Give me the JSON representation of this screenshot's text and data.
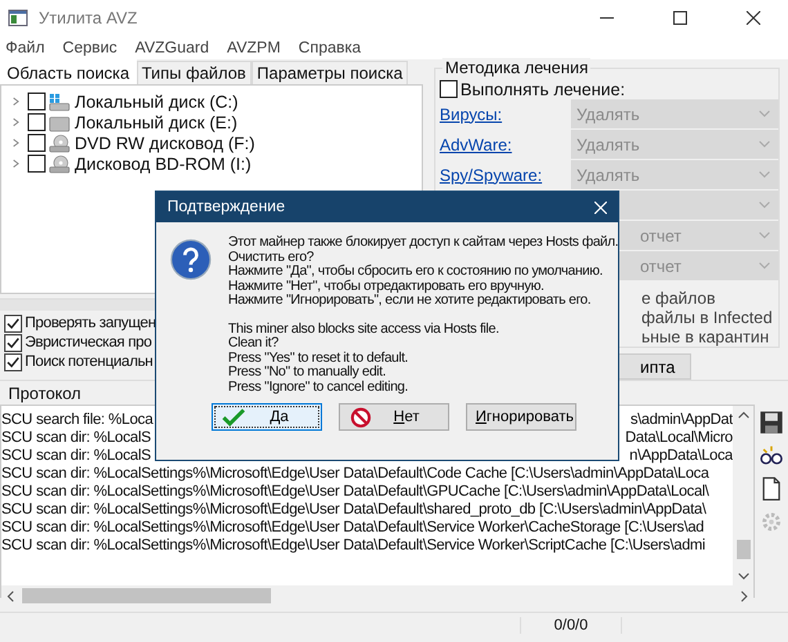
{
  "window": {
    "title": "Утилита AVZ"
  },
  "menu": [
    "Файл",
    "Сервис",
    "AVZGuard",
    "AVZPM",
    "Справка"
  ],
  "tabs": [
    {
      "label": "Область поиска",
      "selected": true
    },
    {
      "label": "Типы файлов",
      "selected": false
    },
    {
      "label": "Параметры поиска",
      "selected": false
    }
  ],
  "tree": [
    {
      "label": "Локальный диск (C:)",
      "checked": false,
      "kind": "system"
    },
    {
      "label": "Локальный диск (E:)",
      "checked": false,
      "kind": "disk"
    },
    {
      "label": "DVD RW дисковод (F:)",
      "checked": false,
      "kind": "optical"
    },
    {
      "label": "Дисковод BD-ROM (I:)",
      "checked": false,
      "kind": "optical"
    }
  ],
  "options": [
    {
      "label": "Проверять запущен",
      "checked": true
    },
    {
      "label": "Эвристическая про",
      "checked": true
    },
    {
      "label": "Поиск потенциальн",
      "checked": true
    }
  ],
  "treatment": {
    "title": "Методика лечения",
    "perform": {
      "label": "Выполнять лечение:",
      "checked": false
    },
    "rows": [
      {
        "label": "Вирусы:",
        "value": "Удалять"
      },
      {
        "label": "AdvWare:",
        "value": "Удалять"
      },
      {
        "label": "Spy/Spyware:",
        "value": "Удалять"
      },
      {
        "value": ""
      },
      {
        "value": "отчет"
      },
      {
        "value": "отчет"
      }
    ],
    "notes": [
      "е файлов",
      "файлы в  Infected",
      "ьные в  карантин"
    ],
    "button": "ипта"
  },
  "protocol": {
    "title": "Протокол",
    "lines": [
      {
        "left": "SCU search file: %Loca",
        "right": "s\\admin\\AppDat"
      },
      {
        "left": "SCU scan dir: %LocalS",
        "right": "Data\\Local\\Micro"
      },
      {
        "left": "SCU scan dir: %LocalS",
        "right": "n\\AppData\\Loca"
      },
      {
        "left": "SCU scan dir: %LocalSettings%\\Microsoft\\Edge\\User Data\\Default\\Code Cache [C:\\Users\\admin\\AppData\\Loca"
      },
      {
        "left": "SCU scan dir: %LocalSettings%\\Microsoft\\Edge\\User Data\\Default\\GPUCache [C:\\Users\\admin\\AppData\\Local\\"
      },
      {
        "left": "SCU scan dir: %LocalSettings%\\Microsoft\\Edge\\User Data\\Default\\shared_proto_db [C:\\Users\\admin\\AppData\\"
      },
      {
        "left": "SCU scan dir: %LocalSettings%\\Microsoft\\Edge\\User Data\\Default\\Service Worker\\CacheStorage [C:\\Users\\ad"
      },
      {
        "left": "SCU scan dir: %LocalSettings%\\Microsoft\\Edge\\User Data\\Default\\Service Worker\\ScriptCache [C:\\Users\\admi"
      }
    ]
  },
  "status_bar": {
    "counter": "0/0/0"
  },
  "dialog": {
    "title": "Подтверждение",
    "message_ru": [
      "Этот майнер также блокирует доступ к сайтам через Hosts файл.",
      "Очистить его?",
      "Нажмите \"Да\", чтобы сбросить его к состоянию по умолчанию.",
      "Нажмите \"Нет\", чтобы отредактировать его вручную.",
      "Нажмите \"Игнорировать\", если не хотите редактировать его."
    ],
    "message_en": [
      "This miner also blocks site access via Hosts file.",
      "Clean it?",
      "Press \"Yes\" to reset it to default.",
      "Press \"No\" to manually edit.",
      "Press \"Ignore\" to cancel editing."
    ],
    "buttons": [
      {
        "label": "Да",
        "kind": "yes",
        "selected": true
      },
      {
        "label": "Нет",
        "kind": "no",
        "selected": false
      },
      {
        "label": "Игнорировать",
        "kind": "ignore",
        "selected": false
      }
    ]
  }
}
